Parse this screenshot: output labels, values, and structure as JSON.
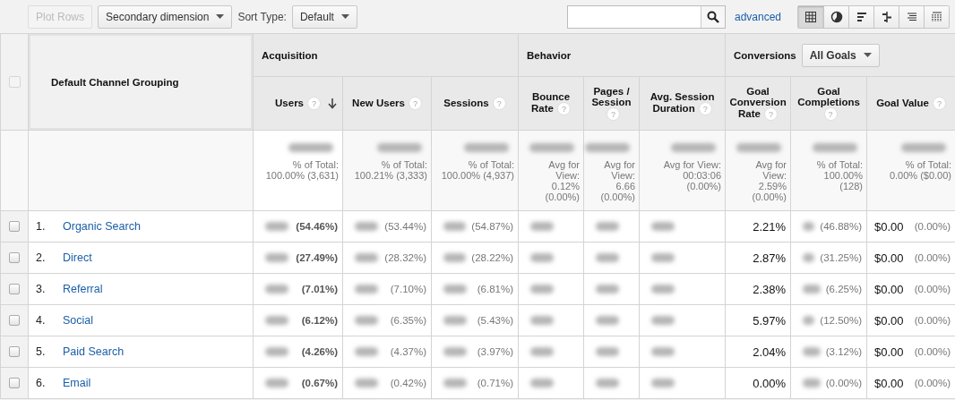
{
  "toolbar": {
    "plot_rows": {
      "label": "Plot Rows",
      "disabled": true
    },
    "secondary_dimension": "Secondary dimension",
    "sort_type_label": "Sort Type:",
    "sort_type": "Default",
    "advanced": "advanced",
    "views": [
      {
        "kind": "table",
        "selected": true
      },
      {
        "kind": "pie",
        "selected": false
      },
      {
        "kind": "bars",
        "selected": false
      },
      {
        "kind": "comparison",
        "selected": false
      },
      {
        "kind": "pivot",
        "selected": false
      },
      {
        "kind": "cloud",
        "selected": false
      }
    ]
  },
  "table": {
    "dimension": "Default Channel Grouping",
    "select_all": {
      "checked": false,
      "disabled": true
    },
    "groups": [
      {
        "label": "Acquisition",
        "columns": [
          {
            "label": "Users",
            "help": "?",
            "sorted": true
          },
          {
            "label": "New Users",
            "help": "?",
            "sorted": false
          },
          {
            "label": "Sessions",
            "help": "?",
            "sorted": false
          }
        ]
      },
      {
        "label": "Behavior",
        "columns": [
          {
            "label": "Bounce Rate",
            "help": "?",
            "sorted": false
          },
          {
            "label": "Pages / Session",
            "help": "?",
            "sorted": false
          },
          {
            "label": "Avg. Session Duration",
            "help": "?",
            "sorted": false
          }
        ]
      },
      {
        "label": "Conversions",
        "dropdown": "All Goals",
        "columns": [
          {
            "label": "Goal Conversion Rate",
            "help": "?",
            "sorted": false
          },
          {
            "label": "Goal Completions",
            "help": "?",
            "sorted": false
          },
          {
            "label": "Goal Value",
            "help": "?",
            "sorted": false
          }
        ]
      }
    ],
    "totals": [
      {
        "blurred": true,
        "note": [
          "% of Total:",
          "100.00% (3,631)"
        ]
      },
      {
        "blurred": true,
        "note": [
          "% of Total:",
          "100.21% (3,333)"
        ]
      },
      {
        "blurred": true,
        "note": [
          "% of Total:",
          "100.00% (4,937)"
        ]
      },
      {
        "blurred": true,
        "note": [
          "Avg for",
          "View:",
          "0.12%",
          "(0.00%)"
        ]
      },
      {
        "blurred": true,
        "note": [
          "Avg for",
          "View:",
          "6.66",
          "(0.00%)"
        ]
      },
      {
        "blurred": true,
        "note": [
          "Avg for View:",
          "00:03:06",
          "(0.00%)"
        ]
      },
      {
        "blurred": true,
        "note": [
          "Avg for",
          "View:",
          "2.59%",
          "(0.00%)"
        ]
      },
      {
        "blurred": true,
        "note": [
          "% of Total:",
          "100.00%",
          "(128)"
        ]
      },
      {
        "blurred": true,
        "note": [
          "% of Total:",
          "0.00% ($0.00)"
        ]
      }
    ],
    "rows": [
      {
        "index": "1.",
        "name": "Organic Search",
        "selected": false,
        "metrics": [
          {
            "blurred": true,
            "pct": "(54.46%)"
          },
          {
            "blurred": true,
            "pct": "(53.44%)"
          },
          {
            "blurred": true,
            "pct": "(54.87%)"
          },
          {
            "blurred": true
          },
          {
            "blurred": true
          },
          {
            "blurred": true
          },
          {
            "blurred": false,
            "value": "2.21%"
          },
          {
            "blurred": true,
            "pct": "(46.88%)"
          },
          {
            "blurred": false,
            "value": "$0.00",
            "pct": "(0.00%)"
          }
        ]
      },
      {
        "index": "2.",
        "name": "Direct",
        "selected": false,
        "metrics": [
          {
            "blurred": true,
            "pct": "(27.49%)"
          },
          {
            "blurred": true,
            "pct": "(28.32%)"
          },
          {
            "blurred": true,
            "pct": "(28.22%)"
          },
          {
            "blurred": true
          },
          {
            "blurred": true
          },
          {
            "blurred": true
          },
          {
            "blurred": false,
            "value": "2.87%"
          },
          {
            "blurred": true,
            "pct": "(31.25%)"
          },
          {
            "blurred": false,
            "value": "$0.00",
            "pct": "(0.00%)"
          }
        ]
      },
      {
        "index": "3.",
        "name": "Referral",
        "selected": false,
        "metrics": [
          {
            "blurred": true,
            "pct": "(7.01%)"
          },
          {
            "blurred": true,
            "pct": "(7.10%)"
          },
          {
            "blurred": true,
            "pct": "(6.81%)"
          },
          {
            "blurred": true
          },
          {
            "blurred": true
          },
          {
            "blurred": true
          },
          {
            "blurred": false,
            "value": "2.38%"
          },
          {
            "blurred": true,
            "pct": "(6.25%)"
          },
          {
            "blurred": false,
            "value": "$0.00",
            "pct": "(0.00%)"
          }
        ]
      },
      {
        "index": "4.",
        "name": "Social",
        "selected": false,
        "metrics": [
          {
            "blurred": true,
            "pct": "(6.12%)"
          },
          {
            "blurred": true,
            "pct": "(6.35%)"
          },
          {
            "blurred": true,
            "pct": "(5.43%)"
          },
          {
            "blurred": true
          },
          {
            "blurred": true
          },
          {
            "blurred": true
          },
          {
            "blurred": false,
            "value": "5.97%"
          },
          {
            "blurred": true,
            "pct": "(12.50%)"
          },
          {
            "blurred": false,
            "value": "$0.00",
            "pct": "(0.00%)"
          }
        ]
      },
      {
        "index": "5.",
        "name": "Paid Search",
        "selected": false,
        "metrics": [
          {
            "blurred": true,
            "pct": "(4.26%)"
          },
          {
            "blurred": true,
            "pct": "(4.37%)"
          },
          {
            "blurred": true,
            "pct": "(3.97%)"
          },
          {
            "blurred": true
          },
          {
            "blurred": true
          },
          {
            "blurred": true
          },
          {
            "blurred": false,
            "value": "2.04%"
          },
          {
            "blurred": true,
            "pct": "(3.12%)"
          },
          {
            "blurred": false,
            "value": "$0.00",
            "pct": "(0.00%)"
          }
        ]
      },
      {
        "index": "6.",
        "name": "Email",
        "selected": false,
        "metrics": [
          {
            "blurred": true,
            "pct": "(0.67%)"
          },
          {
            "blurred": true,
            "pct": "(0.42%)"
          },
          {
            "blurred": true,
            "pct": "(0.71%)"
          },
          {
            "blurred": true
          },
          {
            "blurred": true
          },
          {
            "blurred": true
          },
          {
            "blurred": false,
            "value": "0.00%"
          },
          {
            "blurred": true,
            "pct": "(0.00%)"
          },
          {
            "blurred": false,
            "value": "$0.00",
            "pct": "(0.00%)"
          }
        ]
      }
    ]
  }
}
